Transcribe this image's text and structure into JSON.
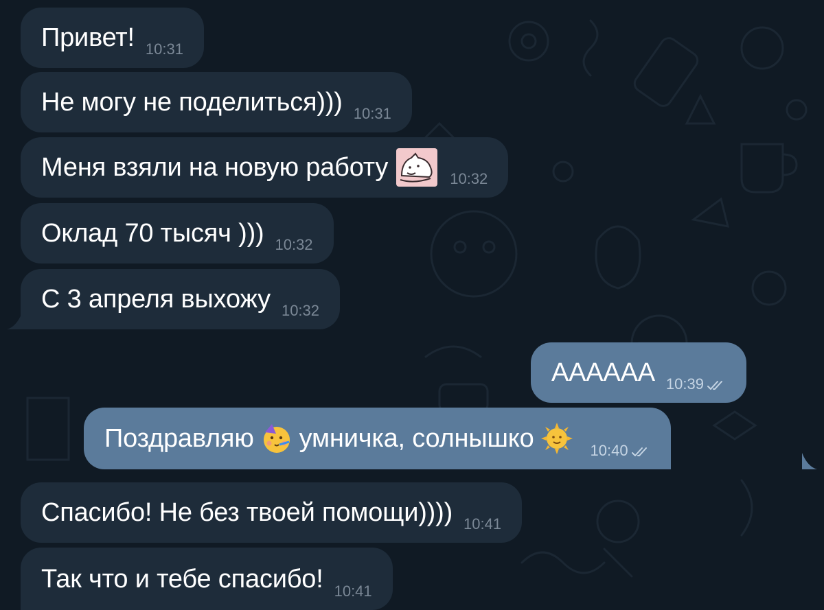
{
  "colors": {
    "background": "#101a24",
    "incoming_bubble": "#1e2c3a",
    "outgoing_bubble": "#5b7b9b",
    "incoming_time": "#7b8896",
    "outgoing_time": "#c6d5e4"
  },
  "messages": [
    {
      "direction": "in",
      "text": "Привет!",
      "time": "10:31"
    },
    {
      "direction": "in",
      "text": "Не могу не поделиться)))",
      "time": "10:31"
    },
    {
      "direction": "in",
      "text": "Меня взяли на новую работу",
      "sticker": "cat-sticker",
      "time": "10:32"
    },
    {
      "direction": "in",
      "text": "Оклад 70 тысяч )))",
      "time": "10:32"
    },
    {
      "direction": "in",
      "text": "С 3 апреля выхожу",
      "time": "10:32"
    },
    {
      "direction": "out",
      "text": "АААААА",
      "time": "10:39",
      "status": "double-check-read"
    },
    {
      "direction": "out",
      "text_before": "Поздравляю",
      "emoji1": "partying-face-emoji",
      "text_middle": "умничка, солнышко",
      "emoji2": "sun-with-face-emoji",
      "time": "10:40",
      "status": "double-check-read"
    },
    {
      "direction": "in",
      "text": "Спасибо! Не без твоей помощи))))",
      "time": "10:41"
    },
    {
      "direction": "in",
      "text": "Так что и тебе спасибо!",
      "time": "10:41"
    }
  ]
}
